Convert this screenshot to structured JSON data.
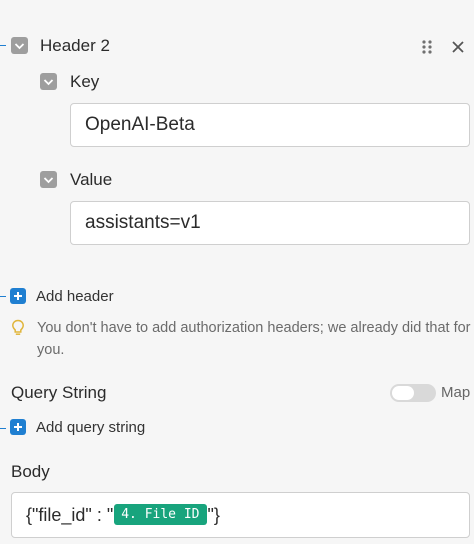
{
  "header_item": {
    "title": "Header 2",
    "key_label": "Key",
    "key_value": "OpenAI-Beta",
    "value_label": "Value",
    "value_value": "assistants=v1"
  },
  "add_header_label": "Add header",
  "auth_hint": "You don't have to add authorization headers; we already did that for you.",
  "query_string": {
    "title": "Query String",
    "map_label": "Map",
    "add_label": "Add query string"
  },
  "body": {
    "title": "Body",
    "prefix": "{\"file_id\" : \"",
    "pill": "4. File ID",
    "suffix": "\"}"
  },
  "colors": {
    "accent": "#1f7fd1",
    "pill": "#18a47d",
    "checkbox": "#9e9e9e"
  }
}
